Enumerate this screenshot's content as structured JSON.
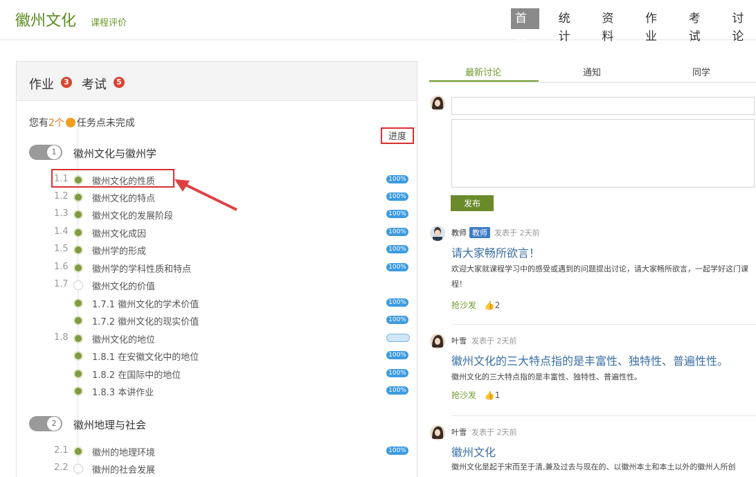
{
  "header": {
    "brand": "徽州文化",
    "brand_sub": "课程评价",
    "nav": [
      "首页",
      "统计",
      "资料",
      "作业",
      "考试",
      "讨论"
    ]
  },
  "left": {
    "homework_label": "作业",
    "homework_count": "3",
    "exam_label": "考试",
    "exam_count": "5",
    "tasks_prefix": "您有",
    "tasks_num": "2个",
    "tasks_suffix": "任务点未完成",
    "progress_label": "进度",
    "chapter1": {
      "num": "1",
      "title": "徽州文化与徽州学"
    },
    "chapter2": {
      "num": "2",
      "title": "徽州地理与社会"
    },
    "rows": [
      {
        "num": "1.1",
        "label": "徽州文化的性质",
        "done": true,
        "pill": "100%"
      },
      {
        "num": "1.2",
        "label": "徽州文化的特点",
        "done": true,
        "pill": "100%"
      },
      {
        "num": "1.3",
        "label": "徽州文化的发展阶段",
        "done": true,
        "pill": "100%"
      },
      {
        "num": "1.4",
        "label": "徽州文化成因",
        "done": true,
        "pill": "100%"
      },
      {
        "num": "1.5",
        "label": "徽州学的形成",
        "done": true,
        "pill": "100%"
      },
      {
        "num": "1.6",
        "label": "徽州学的学科性质和特点",
        "done": true,
        "pill": "100%"
      },
      {
        "num": "1.7",
        "label": "徽州文化的价值",
        "done": false,
        "pill": ""
      },
      {
        "num": "",
        "label": "1.7.1 徽州文化的学术价值",
        "done": true,
        "pill": "100%"
      },
      {
        "num": "",
        "label": "1.7.2 徽州文化的现实价值",
        "done": true,
        "pill": "100%"
      },
      {
        "num": "1.8",
        "label": "徽州文化的地位",
        "done": true,
        "pill": ""
      },
      {
        "num": "",
        "label": "1.8.1 在安徽文化中的地位",
        "done": true,
        "pill": "100%"
      },
      {
        "num": "",
        "label": "1.8.2 在国际中的地位",
        "done": true,
        "pill": "100%"
      },
      {
        "num": "",
        "label": "1.8.3 本讲作业",
        "done": true,
        "pill": "100%"
      },
      {
        "num": "2.1",
        "label": "徽州的地理环境",
        "done": true,
        "pill": "100%"
      },
      {
        "num": "2.2",
        "label": "徽州的社会发展",
        "done": false,
        "pill": ""
      }
    ]
  },
  "right": {
    "tabs": [
      "最新讨论",
      "通知",
      "同学"
    ],
    "publish": "发布",
    "posts": [
      {
        "author": "教师",
        "badge": "教师",
        "time": "发表于 2天前",
        "title": "请大家畅所欲言！",
        "body": "欢迎大家就课程学习中的感受或遇到的问题提出讨论，请大家畅所欲言，一起学好这门课程！",
        "action": "抢沙发",
        "likes": "2"
      },
      {
        "author": "叶雪",
        "time": "发表于 2天前",
        "title": "徽州文化的三大特点指的是丰富性、独特性、普遍性性。",
        "body": "徽州文化的三大特点指的是丰富性、独特性、普遍性性。",
        "action": "抢沙发",
        "likes": "1"
      },
      {
        "author": "叶雪",
        "time": "发表于 2天前",
        "title": "徽州文化",
        "body": "徽州文化是起于宋而至于清,兼及过去与现在的、以徽州本土和本土以外的徽州人所创"
      }
    ]
  },
  "colors": {
    "accent_green": "#6b9a2a",
    "badge_red": "#d9432f",
    "pill_blue": "#3d9be0",
    "highlight_red": "#d93030"
  }
}
